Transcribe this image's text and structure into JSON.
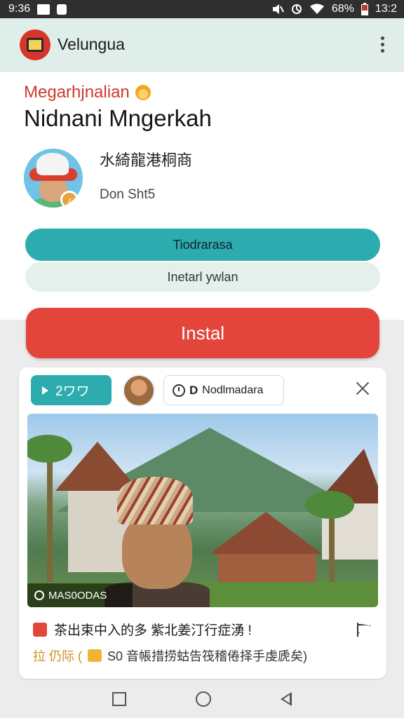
{
  "status_bar": {
    "time": "9:36",
    "battery": "68%",
    "clock_right": "13:2",
    "icons": [
      "image-icon",
      "notification-icon",
      "mute-icon",
      "vpn-icon",
      "wifi-icon",
      "battery-icon"
    ]
  },
  "app_bar": {
    "title": "Velungua",
    "menu_icon": "more-vert-icon"
  },
  "hero": {
    "eyebrow": "Megarhjnalian",
    "headline": "Nidnani Mngerkah",
    "profile_name": "水綺龍港桐商",
    "profile_sub": "Don Sht5",
    "primary_pill": "Tiodrarasa",
    "secondary_pill": "Inetarl ywlan"
  },
  "install_label": "Instal",
  "card": {
    "chip_primary": "2ワワ",
    "chip_secondary_d": "D",
    "chip_secondary_label": "Nodlmadara",
    "photo_caption": "MAS0ODAS",
    "line1": "茶出束中入的多 紫北姜汀行症湧 !",
    "line2_lead": "拉 仍际 (",
    "line2_rest": "S0 音帳措捞蛄告筏稽倦择手虔虒矣)"
  },
  "colors": {
    "teal": "#2cacae",
    "red": "#e4453b",
    "app_bar_bg": "#dfeee8",
    "status_bar_bg": "#2f2f2f"
  },
  "nav": {
    "items": [
      "recents-square-icon",
      "home-circle-icon",
      "back-triangle-icon"
    ]
  }
}
